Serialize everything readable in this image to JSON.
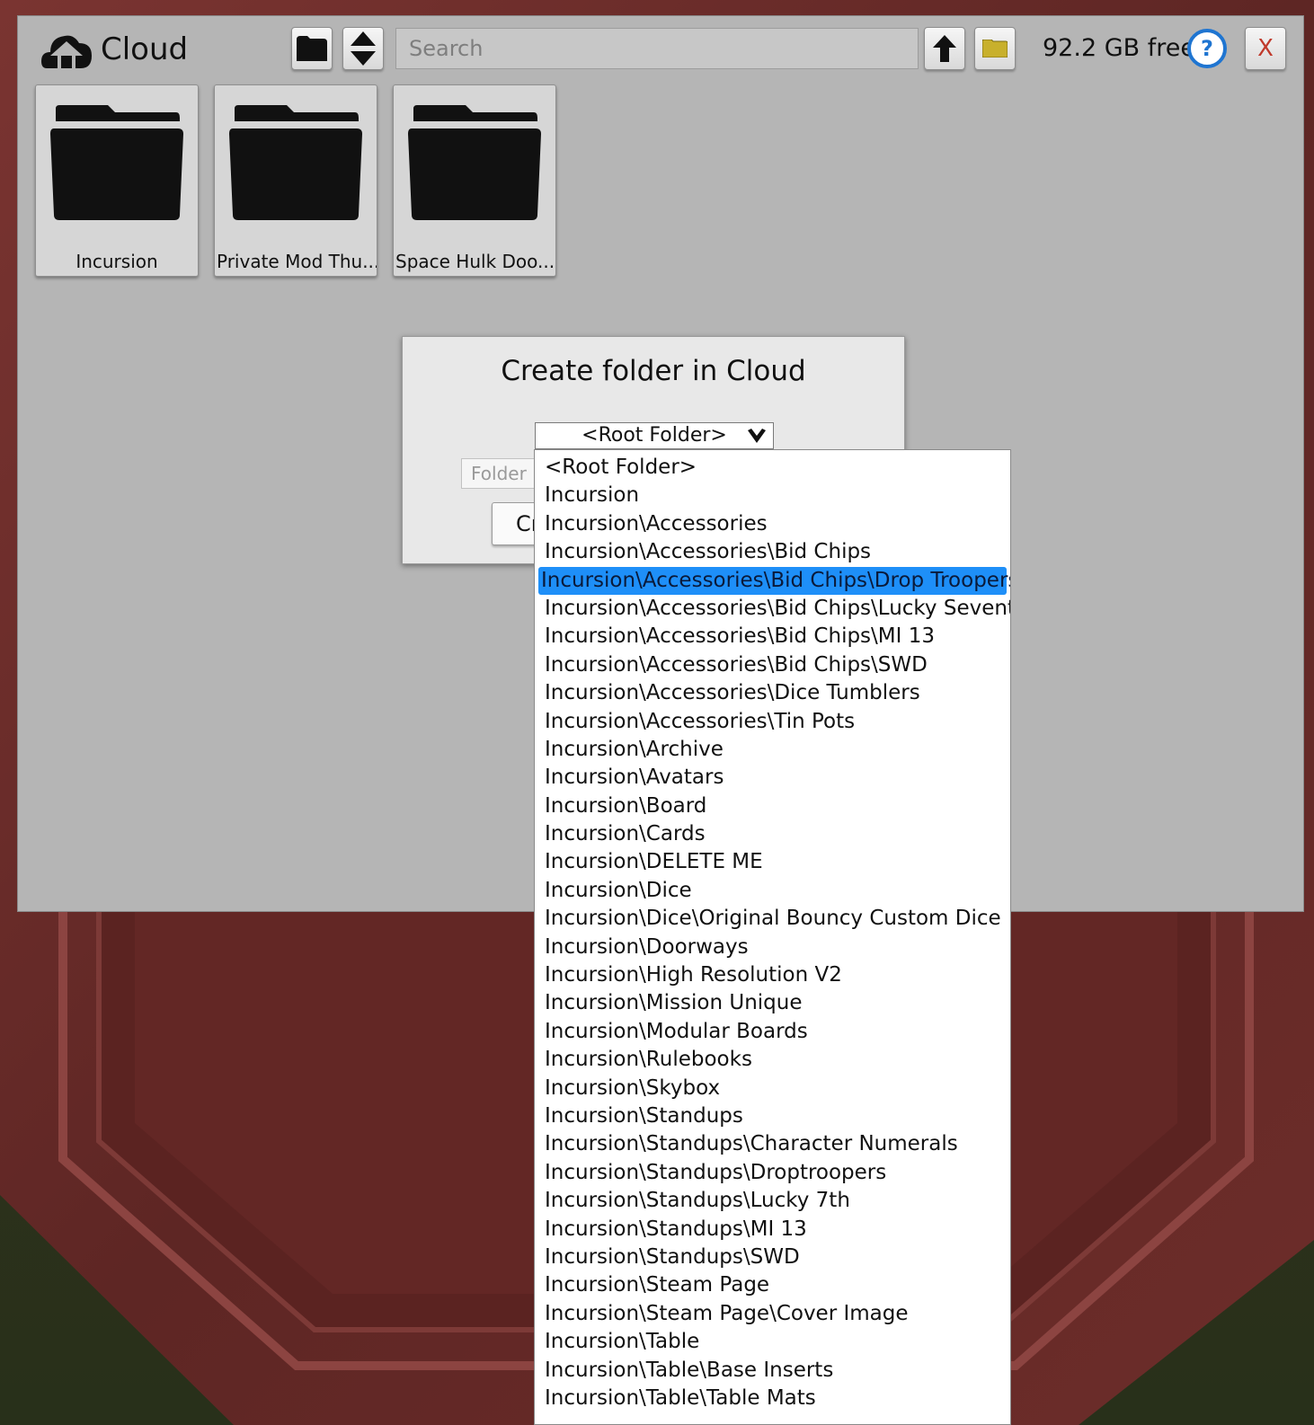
{
  "window": {
    "title": "Cloud",
    "search_placeholder": "Search",
    "free_space": "92.2 GB free",
    "help_label": "?",
    "close_label": "X"
  },
  "folders": [
    {
      "label": "Incursion"
    },
    {
      "label": "Private Mod Thu..."
    },
    {
      "label": "Space Hulk Doo..."
    }
  ],
  "dialog": {
    "title": "Create folder in Cloud",
    "selected": "<Root Folder>",
    "name_placeholder": "Folder Name",
    "create_label": "Create"
  },
  "dropdown": {
    "highlighted_index": 4,
    "options": [
      "<Root Folder>",
      "Incursion",
      "Incursion\\Accessories",
      "Incursion\\Accessories\\Bid Chips",
      "Incursion\\Accessories\\Bid Chips\\Drop Troopers",
      "Incursion\\Accessories\\Bid Chips\\Lucky Seventh",
      "Incursion\\Accessories\\Bid Chips\\MI 13",
      "Incursion\\Accessories\\Bid Chips\\SWD",
      "Incursion\\Accessories\\Dice Tumblers",
      "Incursion\\Accessories\\Tin Pots",
      "Incursion\\Archive",
      "Incursion\\Avatars",
      "Incursion\\Board",
      "Incursion\\Cards",
      "Incursion\\DELETE ME",
      "Incursion\\Dice",
      "Incursion\\Dice\\Original Bouncy Custom Dice",
      "Incursion\\Doorways",
      "Incursion\\High Resolution V2",
      "Incursion\\Mission Unique",
      "Incursion\\Modular Boards",
      "Incursion\\Rulebooks",
      "Incursion\\Skybox",
      "Incursion\\Standups",
      "Incursion\\Standups\\Character Numerals",
      "Incursion\\Standups\\Droptroopers",
      "Incursion\\Standups\\Lucky 7th",
      "Incursion\\Standups\\MI 13",
      "Incursion\\Standups\\SWD",
      "Incursion\\Steam Page",
      "Incursion\\Steam Page\\Cover Image",
      "Incursion\\Table",
      "Incursion\\Table\\Base Inserts",
      "Incursion\\Table\\Table Mats"
    ]
  },
  "colors": {
    "window_bg": "#b5b5b5",
    "highlight": "#1e8ff8",
    "help_blue": "#1f75d1",
    "close_red": "#c0392b",
    "table_wood": "#6b2a28"
  },
  "icons": {
    "title": "cloud-upload-icon",
    "browse": "folder-icon",
    "sort": "sort-icon",
    "up": "arrow-up-icon",
    "new_folder": "new-folder-icon",
    "help": "help-icon"
  }
}
